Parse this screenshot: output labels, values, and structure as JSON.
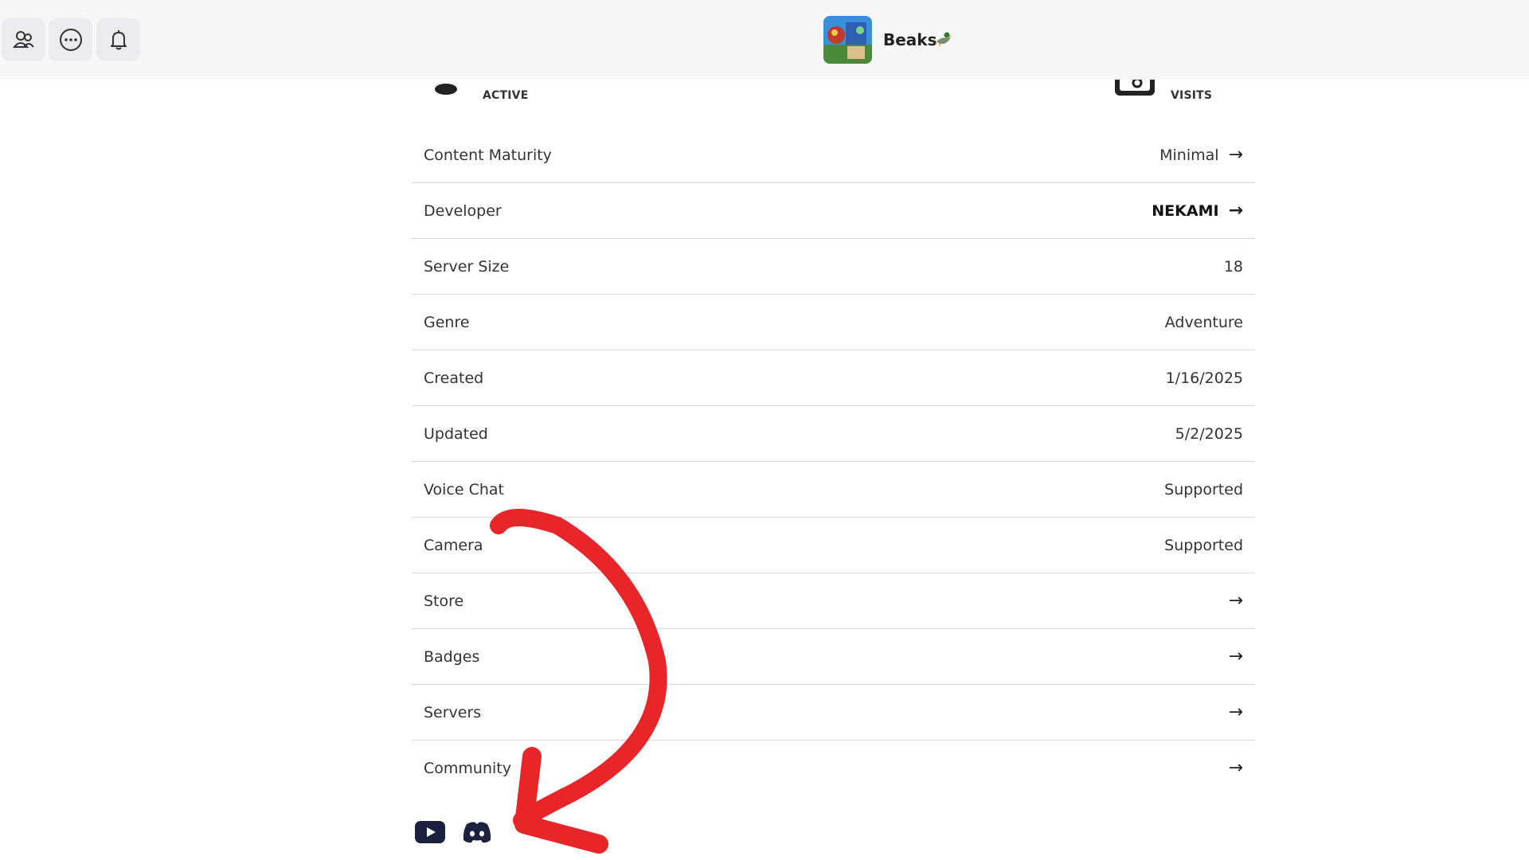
{
  "header": {
    "game_title": "Beaks",
    "game_emoji": "🦆",
    "buttons": [
      "friends-icon",
      "more-icon",
      "bell-icon"
    ]
  },
  "stats": {
    "active_label": "ACTIVE",
    "visits_label": "VISITS"
  },
  "details": [
    {
      "label": "Content Maturity",
      "value": "Minimal",
      "arrow": "→",
      "bold": false
    },
    {
      "label": "Developer",
      "value": "NEKAMI",
      "arrow": "→",
      "bold": true
    },
    {
      "label": "Server Size",
      "value": "18",
      "arrow": "",
      "bold": false
    },
    {
      "label": "Genre",
      "value": "Adventure",
      "arrow": "",
      "bold": false
    },
    {
      "label": "Created",
      "value": "1/16/2025",
      "arrow": "",
      "bold": false
    },
    {
      "label": "Updated",
      "value": "5/2/2025",
      "arrow": "",
      "bold": false
    },
    {
      "label": "Voice Chat",
      "value": "Supported",
      "arrow": "",
      "bold": false
    },
    {
      "label": "Camera",
      "value": "Supported",
      "arrow": "",
      "bold": false
    },
    {
      "label": "Store",
      "value": "",
      "arrow": "→",
      "bold": false
    },
    {
      "label": "Badges",
      "value": "",
      "arrow": "→",
      "bold": false
    },
    {
      "label": "Servers",
      "value": "",
      "arrow": "→",
      "bold": false
    },
    {
      "label": "Community",
      "value": "",
      "arrow": "→",
      "bold": false
    }
  ],
  "social_links": [
    "youtube-icon",
    "discord-icon"
  ],
  "colors": {
    "annotation_arrow": "#e8262a",
    "icon_dark": "#1b2240"
  }
}
